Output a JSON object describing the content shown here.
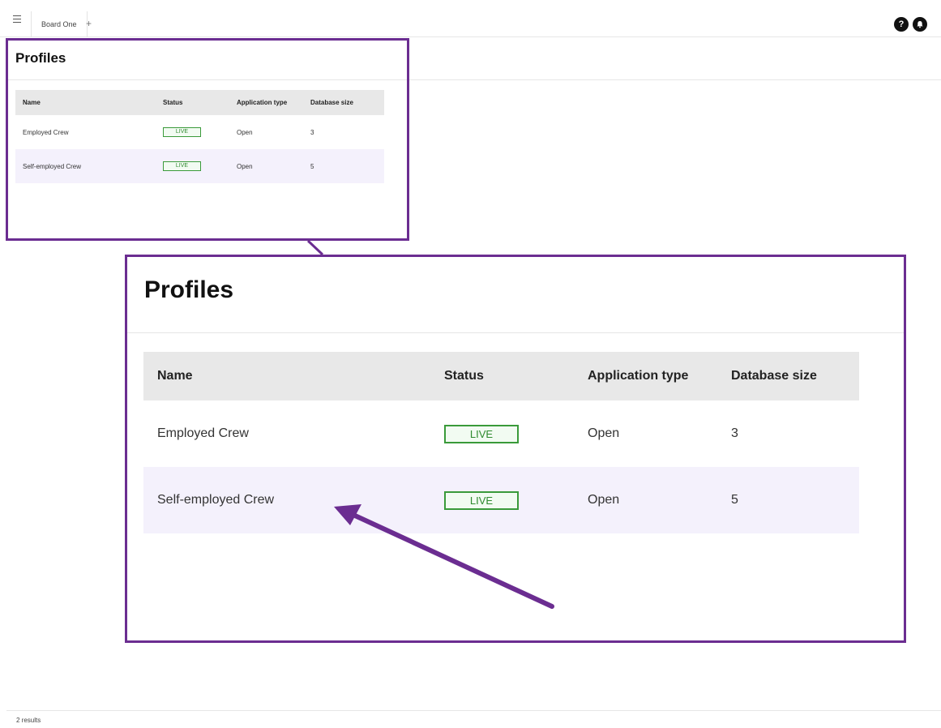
{
  "topbar": {
    "tab_label": "Board One",
    "add_tab": "+",
    "help_icon_glyph": "?",
    "icons": [
      "menu-icon",
      "help-icon",
      "bell-icon"
    ]
  },
  "page": {
    "title": "Profiles",
    "table": {
      "columns": [
        "Name",
        "Status",
        "Application type",
        "Database size"
      ],
      "rows": [
        {
          "name": "Employed Crew",
          "status": "LIVE",
          "application_type": "Open",
          "database_size": "3"
        },
        {
          "name": "Self-employed Crew",
          "status": "LIVE",
          "application_type": "Open",
          "database_size": "5"
        }
      ]
    }
  },
  "footer": {
    "results": "2 results"
  },
  "colors": {
    "annotation": "#6b2d91",
    "live_badge": "#3a9a3a",
    "row_highlight": "#f4f1fc",
    "header_bg": "#e8e8e8"
  }
}
